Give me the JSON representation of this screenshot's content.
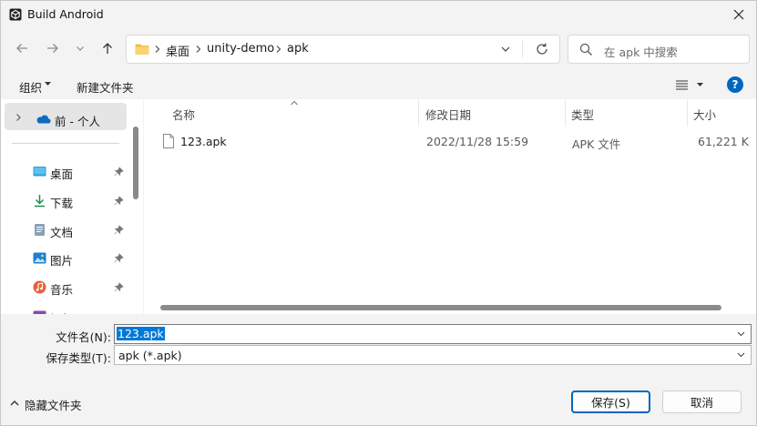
{
  "window": {
    "title": "Build Android"
  },
  "address": {
    "crumbs": [
      "桌面",
      "unity-demo",
      "apk"
    ]
  },
  "search": {
    "placeholder": "在 apk 中搜索"
  },
  "commands": {
    "organize": "组织",
    "new_folder": "新建文件夹"
  },
  "nav": {
    "selected": "前 - 个人",
    "items": [
      {
        "label": "桌面",
        "icon": "desktop-icon"
      },
      {
        "label": "下载",
        "icon": "download-icon"
      },
      {
        "label": "文档",
        "icon": "document-icon"
      },
      {
        "label": "图片",
        "icon": "picture-icon"
      },
      {
        "label": "音乐",
        "icon": "music-icon"
      },
      {
        "label": "视频",
        "icon": "video-icon"
      }
    ]
  },
  "columns": {
    "name": "名称",
    "modified": "修改日期",
    "type": "类型",
    "size": "大小"
  },
  "files": [
    {
      "name": "123.apk",
      "modified": "2022/11/28 15:59",
      "type": "APK 文件",
      "size": "61,221 K"
    }
  ],
  "form": {
    "filename_label": "文件名(N):",
    "filename_value": "123.apk",
    "filetype_label": "保存类型(T):",
    "filetype_value": "apk (*.apk)",
    "hide_folders": "隐藏文件夹",
    "save": "保存(S)",
    "cancel": "取消"
  },
  "colors": {
    "accent": "#0067c0",
    "selection": "#0078d7"
  }
}
